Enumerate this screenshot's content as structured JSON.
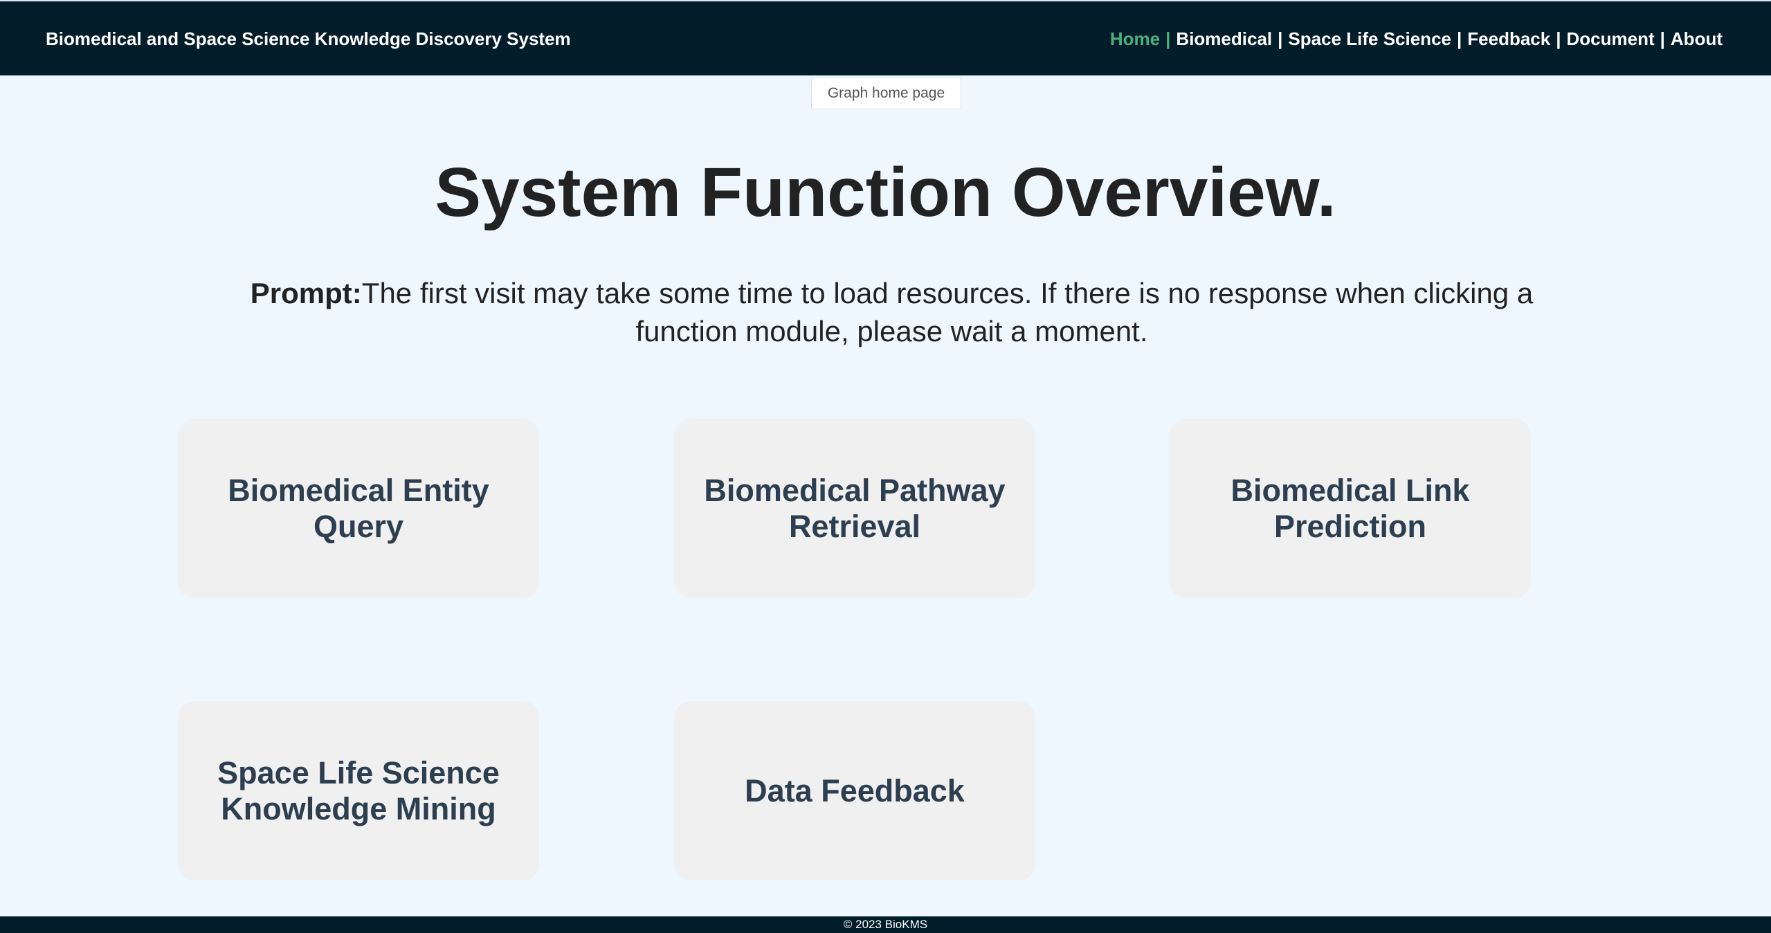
{
  "header": {
    "brand": "Biomedical and Space Science Knowledge Discovery System",
    "nav": [
      {
        "label": "Home",
        "active": true
      },
      {
        "label": "Biomedical",
        "active": false
      },
      {
        "label": "Space Life Science",
        "active": false
      },
      {
        "label": "Feedback",
        "active": false
      },
      {
        "label": "Document",
        "active": false
      },
      {
        "label": "About",
        "active": false
      }
    ],
    "separator": "|"
  },
  "graph_home_button": "Graph home page",
  "main": {
    "title": "System Function Overview.",
    "prompt_label": "Prompt:",
    "prompt_text": "The first visit may take some time to load resources. If there is no response when clicking a function module, please wait a moment.",
    "cards": [
      {
        "label": "Biomedical Entity Query"
      },
      {
        "label": "Biomedical Pathway Retrieval"
      },
      {
        "label": "Biomedical Link Prediction"
      },
      {
        "label": "Space Life Science Knowledge Mining"
      },
      {
        "label": "Data Feedback"
      }
    ]
  },
  "footer": {
    "copyright": "© 2023 BioKMS"
  },
  "colors": {
    "header_bg": "#031d2a",
    "page_bg": "#eef7fd",
    "active_nav": "#4caf7f",
    "card_bg": "#f0f0f0",
    "card_text": "#2c3e50"
  }
}
